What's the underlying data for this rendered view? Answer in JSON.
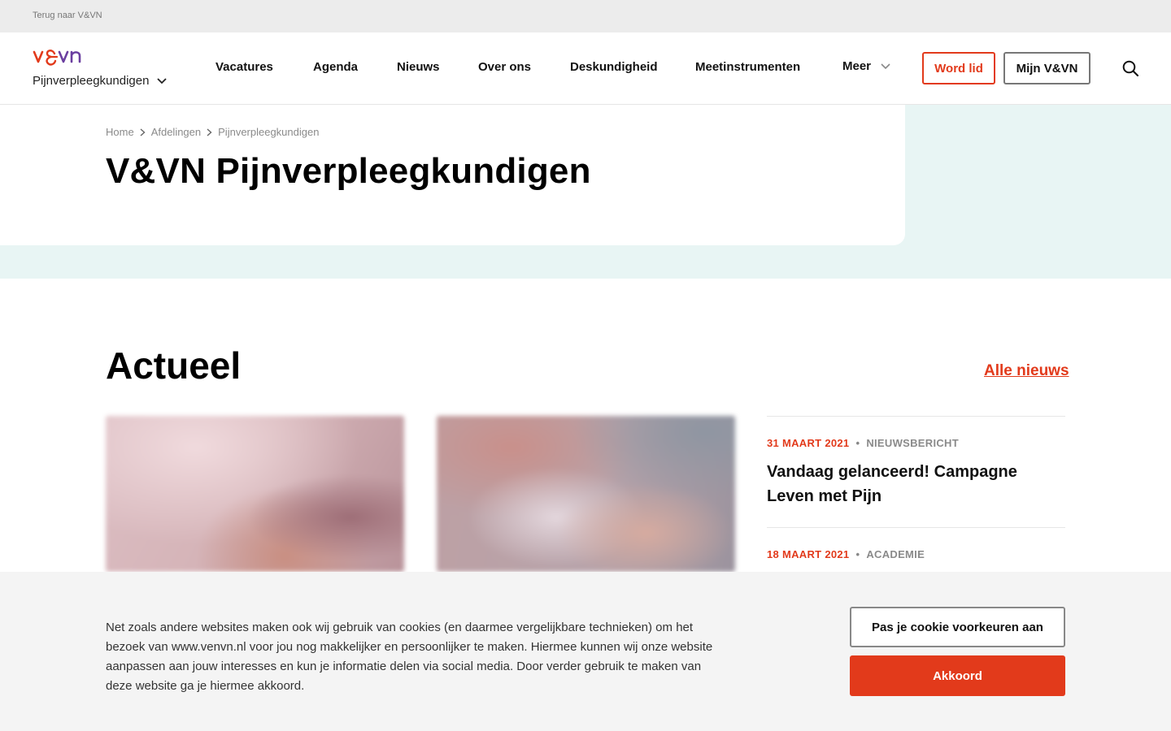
{
  "topbar": {
    "back_link": "Terug naar V&VN"
  },
  "header": {
    "logo_alt": "v&vn",
    "department": "Pijnverpleegkundigen",
    "nav": [
      "Vacatures",
      "Agenda",
      "Nieuws",
      "Over ons",
      "Deskundigheid",
      "Meetinstrumenten"
    ],
    "more": "Meer",
    "join_label": "Word lid",
    "account_label": "Mijn V&VN"
  },
  "breadcrumb": [
    "Home",
    "Afdelingen",
    "Pijnverpleegkundigen"
  ],
  "hero": {
    "title": "V&VN Pijnverpleegkundigen"
  },
  "actueel": {
    "title": "Actueel",
    "all_link": "Alle nieuws",
    "items": [
      {
        "date": "31 MAART 2021",
        "category": "NIEUWSBERICHT",
        "title": "Vandaag gelanceerd! Campagne Leven met Pijn"
      },
      {
        "date": "18 MAART 2021",
        "category": "ACADEMIE"
      }
    ]
  },
  "cookie": {
    "text": "Net zoals andere websites maken ook wij gebruik van cookies (en daarmee vergelijkbare technieken) om het bezoek van www.venvn.nl voor jou nog makkelijker en persoonlijker te maken. Hiermee kunnen wij onze website aanpassen aan jouw interesses en kun je informatie delen via social media. Door verder gebruik te maken van deze website ga je hiermee akkoord.",
    "preferences_label": "Pas je cookie voorkeuren aan",
    "accept_label": "Akkoord"
  },
  "colors": {
    "accent": "#e23a1b",
    "logo_purple": "#6b3fa0",
    "hero_bg": "#e8f5f4"
  }
}
